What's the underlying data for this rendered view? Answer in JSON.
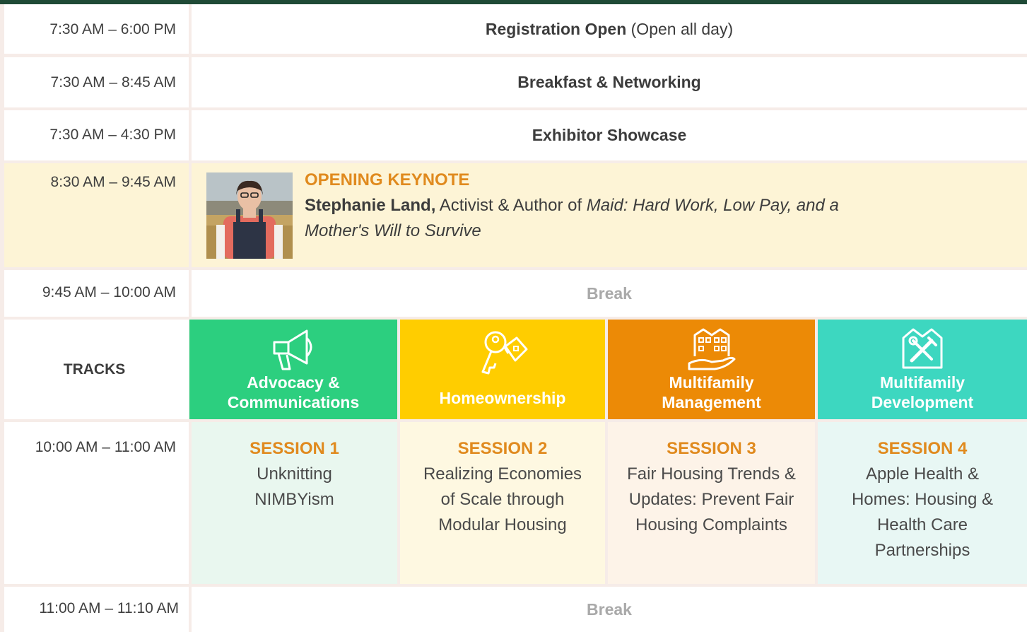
{
  "schedule": {
    "row_registration": {
      "time": "7:30 AM – 6:00 PM",
      "title": "Registration Open",
      "note": " (Open all day)"
    },
    "row_breakfast": {
      "time": "7:30 AM – 8:45 AM",
      "title": "Breakfast & Networking"
    },
    "row_exhibitor": {
      "time": "7:30 AM – 4:30 PM",
      "title": "Exhibitor Showcase"
    },
    "row_keynote": {
      "time": "8:30 AM – 9:45 AM",
      "label": "OPENING KEYNOTE",
      "speaker": "Stephanie Land,",
      "role": " Activist & Author of ",
      "book": "Maid: Hard Work, Low Pay, and a Mother's Will to Survive"
    },
    "row_break1": {
      "time": "9:45 AM – 10:00 AM",
      "title": "Break"
    },
    "tracks_header": "TRACKS",
    "tracks": [
      {
        "line1": "Advocacy &",
        "line2": "Communications",
        "icon": "megaphone-icon",
        "color": "#2ccf7f"
      },
      {
        "line1": "Homeownership",
        "line2": "",
        "icon": "keys-icon",
        "color": "#ffcd00"
      },
      {
        "line1": "Multifamily",
        "line2": "Management",
        "icon": "apartment-building-icon",
        "color": "#ec8a06"
      },
      {
        "line1": "Multifamily",
        "line2": "Development",
        "icon": "tools-icon",
        "color": "#3dd7c0"
      }
    ],
    "sessions_time": "10:00 AM – 11:00 AM",
    "sessions": [
      {
        "label": "SESSION 1",
        "l1": "Unknitting",
        "l2": "NIMBYism",
        "l3": "",
        "l4": "",
        "bg": "#e9f7ef"
      },
      {
        "label": "SESSION 2",
        "l1": "Realizing Economies",
        "l2": "of Scale through",
        "l3": "Modular Housing",
        "l4": "",
        "bg": "#fef8e1"
      },
      {
        "label": "SESSION 3",
        "l1": "Fair Housing Trends &",
        "l2": "Updates: Prevent Fair",
        "l3": "Housing Complaints",
        "l4": "",
        "bg": "#fdf3e8"
      },
      {
        "label": "SESSION 4",
        "l1": "Apple Health &",
        "l2": "Homes: Housing &",
        "l3": "Health Care",
        "l4": "Partnerships",
        "bg": "#e8f7f4"
      }
    ],
    "row_break2": {
      "time": "11:00 AM – 11:10 AM",
      "title": "Break"
    }
  },
  "colors": {
    "keynote_bg": "#fdf4d6",
    "accent_orange": "#e08a1e",
    "top_bar": "#1f4a36"
  }
}
